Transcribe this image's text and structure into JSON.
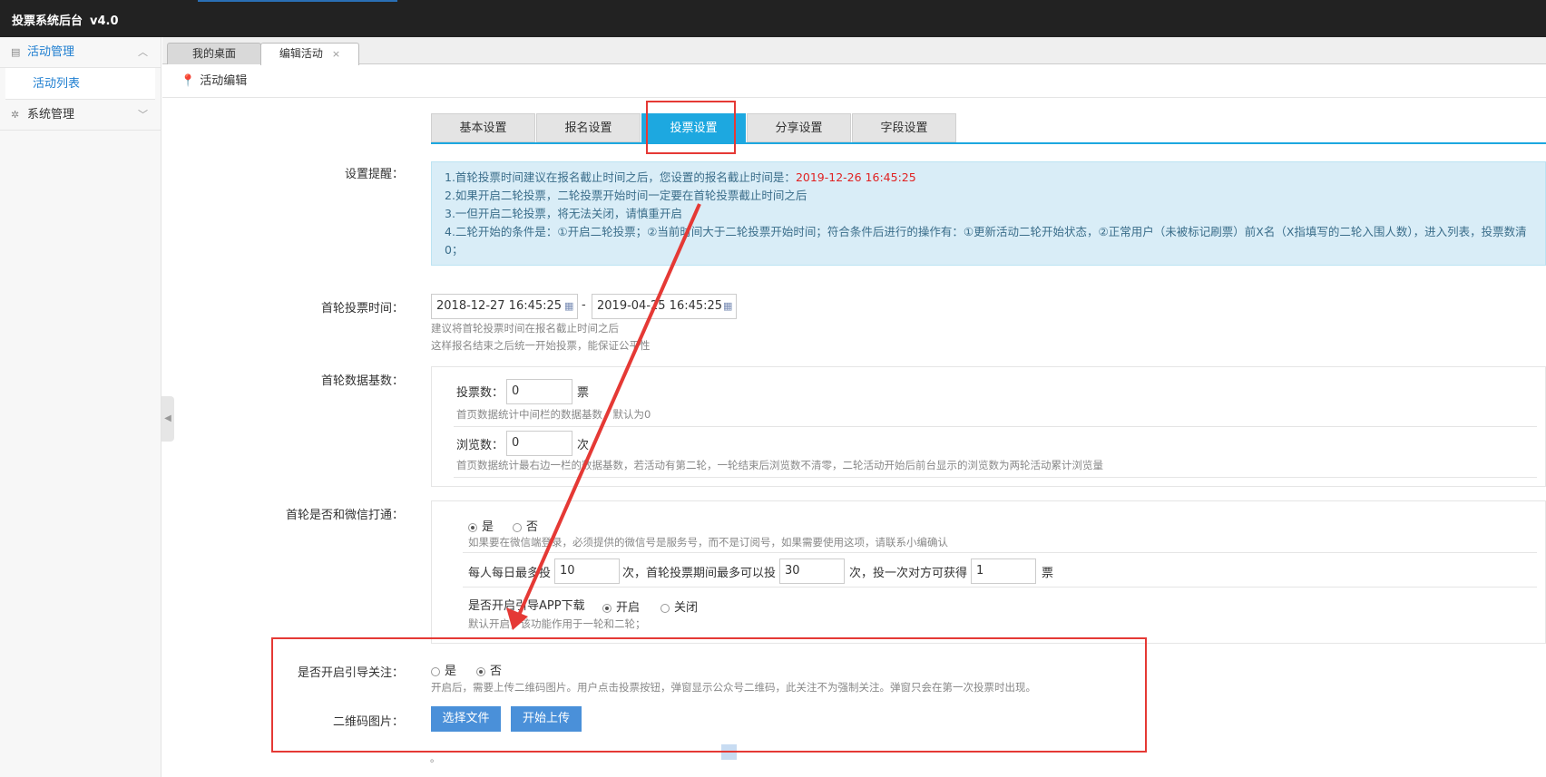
{
  "app": {
    "title": "投票系统后台",
    "version": "v4.0"
  },
  "sidebar": {
    "items": [
      {
        "label": "活动管理",
        "icon": "list-icon",
        "chevron": "︿"
      },
      {
        "label": "系统管理",
        "icon": "gear-icon",
        "chevron": "﹀"
      }
    ],
    "sub_items": [
      {
        "label": "活动列表"
      }
    ]
  },
  "page_tabs": [
    {
      "label": "我的桌面"
    },
    {
      "label": "编辑活动",
      "close": "×"
    }
  ],
  "breadcrumb": {
    "label": "活动编辑"
  },
  "section_tabs": [
    {
      "label": "基本设置"
    },
    {
      "label": "报名设置"
    },
    {
      "label": "投票设置",
      "active": true
    },
    {
      "label": "分享设置"
    },
    {
      "label": "字段设置"
    }
  ],
  "form": {
    "notice_label": "设置提醒：",
    "notice": {
      "line1_prefix": "1.首轮投票时间建议在报名截止时间之后，您设置的报名截止时间是：",
      "line1_date": "2019-12-26 16:45:25",
      "line2": "2.如果开启二轮投票，二轮投票开始时间一定要在首轮投票截止时间之后",
      "line3": "3.一但开启二轮投票，将无法关闭，请慎重开启",
      "line4": "4.二轮开始的条件是：①开启二轮投票；②当前时间大于二轮投票开始时间；符合条件后进行的操作有：①更新活动二轮开始状态，②正常用户（未被标记刷票）前X名（X指填写的二轮入围人数），进入列表，投票数清0；"
    },
    "first_round_time": {
      "label": "首轮投票时间：",
      "start": "2018-12-27 16:45:25",
      "separator": "-",
      "end": "2019-04-25 16:45:25",
      "hint1": "建议将首轮投票时间在报名截止时间之后",
      "hint2": "这样报名结束之后统一开始投票，能保证公平性"
    },
    "first_round_base": {
      "label": "首轮数据基数：",
      "votes_label": "投票数：",
      "votes_value": "0",
      "votes_unit": "票",
      "votes_hint": "首页数据统计中间栏的数据基数，默认为0",
      "views_label": "浏览数：",
      "views_value": "0",
      "views_unit": "次",
      "views_hint": "首页数据统计最右边一栏的数据基数，若活动有第二轮，一轮结束后浏览数不清零，二轮活动开始后前台显示的浏览数为两轮活动累计浏览量"
    },
    "wechat": {
      "label": "首轮是否和微信打通：",
      "yes": "是",
      "no": "否",
      "selected": "是",
      "hint": "如果要在微信端登录，必须提供的微信号是服务号，而不是订阅号，如果需要使用这项，请联系小编确认",
      "daily_prefix": "每人每日最多投",
      "daily_value": "10",
      "period_prefix": "次，首轮投票期间最多可以投",
      "period_value": "30",
      "gain_prefix": "次，投一次对方可获得",
      "gain_value": "1",
      "gain_unit": "票",
      "app_label": "是否开启引导APP下载",
      "app_on": "开启",
      "app_off": "关闭",
      "app_selected": "开启",
      "app_hint": "默认开启，该功能作用于一轮和二轮；"
    },
    "follow": {
      "label": "是否开启引导关注：",
      "yes": "是",
      "no": "否",
      "selected": "否",
      "hint": "开启后，需要上传二维码图片。用户点击投票按钮，弹窗显示公众号二维码，此关注不为强制关注。弹窗只会在第一次投票时出现。"
    },
    "qrcode": {
      "label": "二维码图片：",
      "choose_btn": "选择文件",
      "upload_btn": "开始上传",
      "tail": "。"
    }
  },
  "annotation": {
    "color": "#e53935"
  }
}
